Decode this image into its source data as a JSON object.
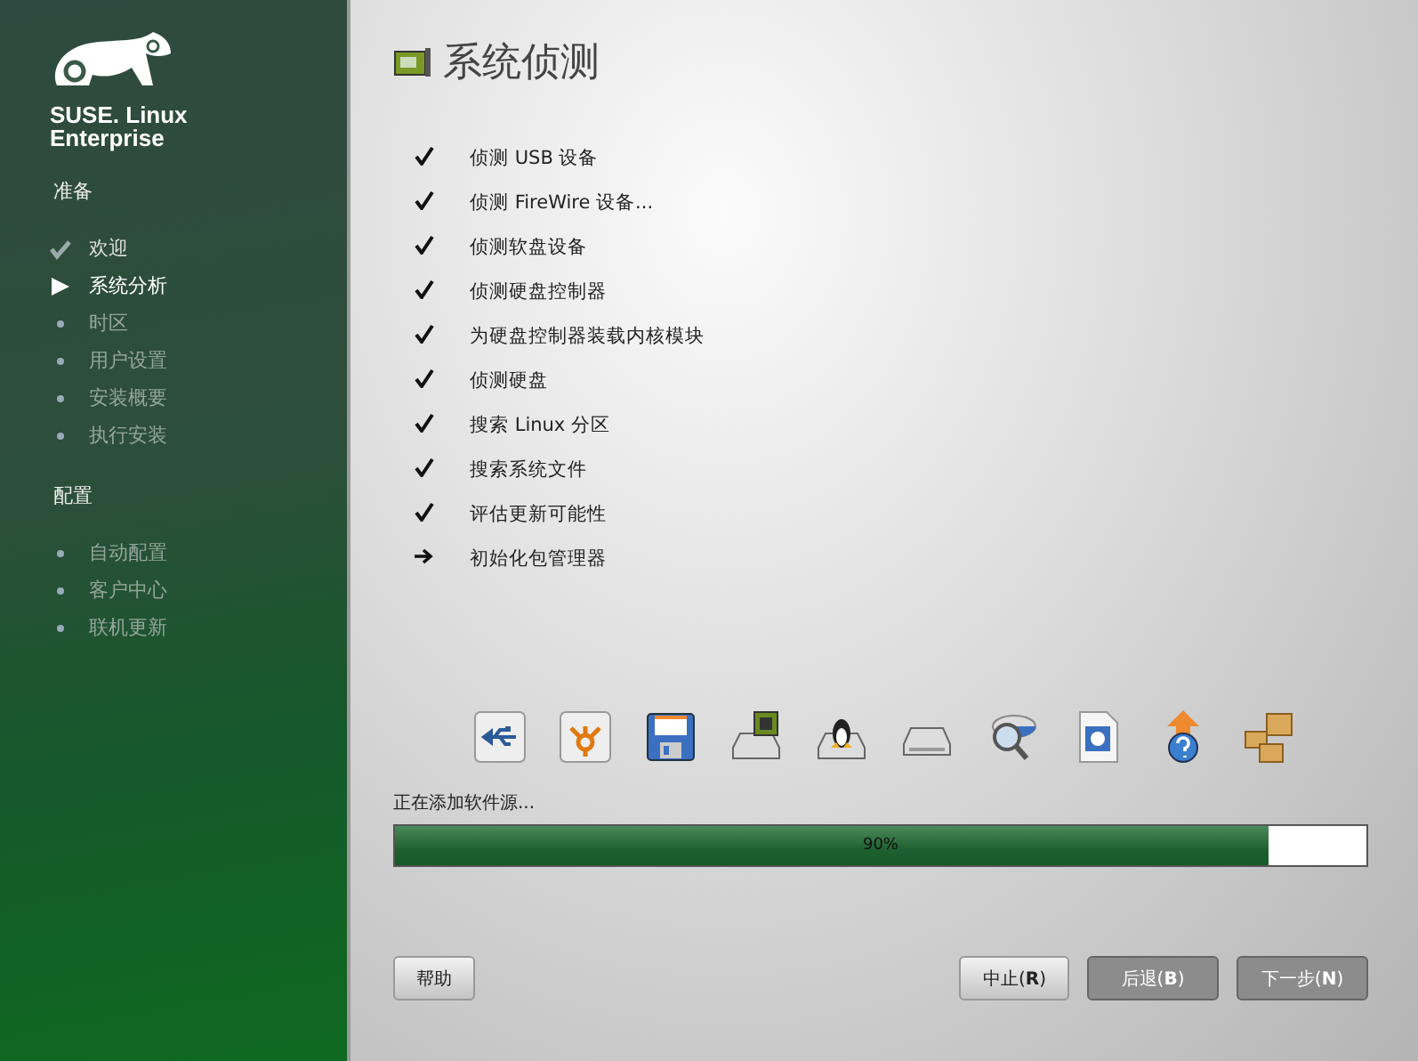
{
  "sidebar": {
    "brand": "SUSE. Linux Enterprise",
    "sections": [
      {
        "title": "准备",
        "steps": [
          {
            "label": "欢迎",
            "done": true,
            "selected": false
          },
          {
            "label": "系统分析",
            "done": false,
            "selected": true
          },
          {
            "label": "时区",
            "done": false,
            "selected": false
          },
          {
            "label": "用户设置",
            "done": false,
            "selected": false
          },
          {
            "label": "安装概要",
            "done": false,
            "selected": false
          },
          {
            "label": "执行安装",
            "done": false,
            "selected": false
          }
        ]
      },
      {
        "title": "配置",
        "steps": [
          {
            "label": "自动配置",
            "done": false,
            "selected": false
          },
          {
            "label": "客户中心",
            "done": false,
            "selected": false
          },
          {
            "label": "联机更新",
            "done": false,
            "selected": false
          }
        ]
      }
    ]
  },
  "page": {
    "title": "系统侦测"
  },
  "tasks": [
    {
      "label": "侦测 USB 设备",
      "done": true
    },
    {
      "label": "侦测 FireWire 设备...",
      "done": true
    },
    {
      "label": "侦测软盘设备",
      "done": true
    },
    {
      "label": "侦测硬盘控制器",
      "done": true
    },
    {
      "label": "为硬盘控制器装载内核模块",
      "done": true
    },
    {
      "label": "侦测硬盘",
      "done": true
    },
    {
      "label": "搜索 Linux 分区",
      "done": true
    },
    {
      "label": "搜索系统文件",
      "done": true
    },
    {
      "label": "评估更新可能性",
      "done": true
    },
    {
      "label": "初始化包管理器",
      "done": false
    }
  ],
  "progress": {
    "status": "正在添加软件源...",
    "level": 0.9,
    "reading": "90%"
  },
  "buttons": [
    {
      "label": "帮助",
      "disabled": false
    },
    {
      "label": "中止(**R**)",
      "disabled": false
    },
    {
      "label": "后退(**B**)",
      "disabled": true
    },
    {
      "label": "下一步(**N**)",
      "disabled": true
    }
  ]
}
